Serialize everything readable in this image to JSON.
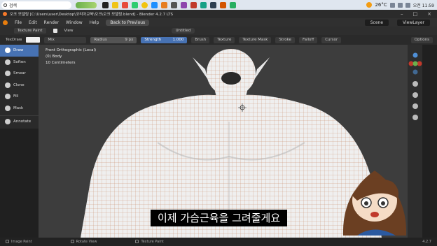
{
  "taskbar": {
    "search_label": "검색",
    "temperature": "26°C",
    "clock": "오전 11:59"
  },
  "window": {
    "title": "오크 모델링 [C:\\Users\\user\\Desktop\\코리아교육\\오크\\오크 모델링.blend] - Blender 4.2.7 LTS"
  },
  "menubar": {
    "items": [
      "File",
      "Edit",
      "Render",
      "Window",
      "Help"
    ],
    "back_button": "Back to Previous",
    "scene": "Scene",
    "view_layer": "ViewLayer"
  },
  "header": {
    "mode": "Texture Paint",
    "view": "View",
    "image": "Untitled"
  },
  "tool_settings": {
    "brush": "TexDraw",
    "blend": "Mix",
    "radius_label": "Radius",
    "radius_value": "9 px",
    "strength_label": "Strength",
    "strength_value": "1.000",
    "dropdowns": [
      "Brush",
      "Texture",
      "Texture Mask",
      "Stroke",
      "Falloff",
      "Cursor"
    ],
    "options": "Options"
  },
  "tools": [
    "Draw",
    "Soften",
    "Smear",
    "Clone",
    "Fill",
    "Mask",
    "Annotate"
  ],
  "viewport": {
    "view_name": "Front Orthographic (Local)",
    "object": "(0) Body",
    "scale": "10 Centimeters"
  },
  "statusbar": {
    "items": [
      "Image Paint",
      "Rotate View",
      "Texture Paint"
    ],
    "version": "4.2.7"
  },
  "subtitle": "이제 가슴근육을 그려줄게요",
  "colors": {
    "accent": "#4772b3",
    "viewport": "#3d3d3d",
    "mesh": "#efefef",
    "wire": "#c98f70"
  }
}
